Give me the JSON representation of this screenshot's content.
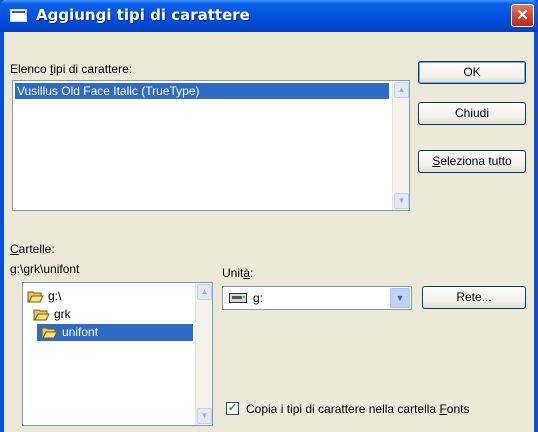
{
  "window": {
    "title": "Aggiungi tipi di carattere",
    "close_symbol": "✕"
  },
  "font_list": {
    "label_prefix": "Elenco ",
    "label_accel": "t",
    "label_suffix": "ipi di carattere:",
    "items": [
      "Vusillus Old Face Italic (TrueType)"
    ]
  },
  "buttons": {
    "ok": "OK",
    "close": "Chiudi",
    "select_all_accel": "S",
    "select_all_rest": "eleziona tutto",
    "network": "Rete..."
  },
  "folders": {
    "label_accel": "C",
    "label_rest": "artelle:",
    "current_path": "g:\\grk\\unifont",
    "items": [
      "g:\\",
      "grk",
      "unifont"
    ]
  },
  "drive": {
    "label_prefix": "Unit",
    "label_accel": "à",
    "label_suffix": ":",
    "value": "g:"
  },
  "copy_option": {
    "checked": true,
    "label_prefix": "Copia i tipi di carattere nella cartella ",
    "label_accel": "F",
    "label_suffix": "onts"
  },
  "colors": {
    "titlebar": "#0054e3",
    "selection": "#316ac5",
    "dialog": "#ece9d8"
  }
}
